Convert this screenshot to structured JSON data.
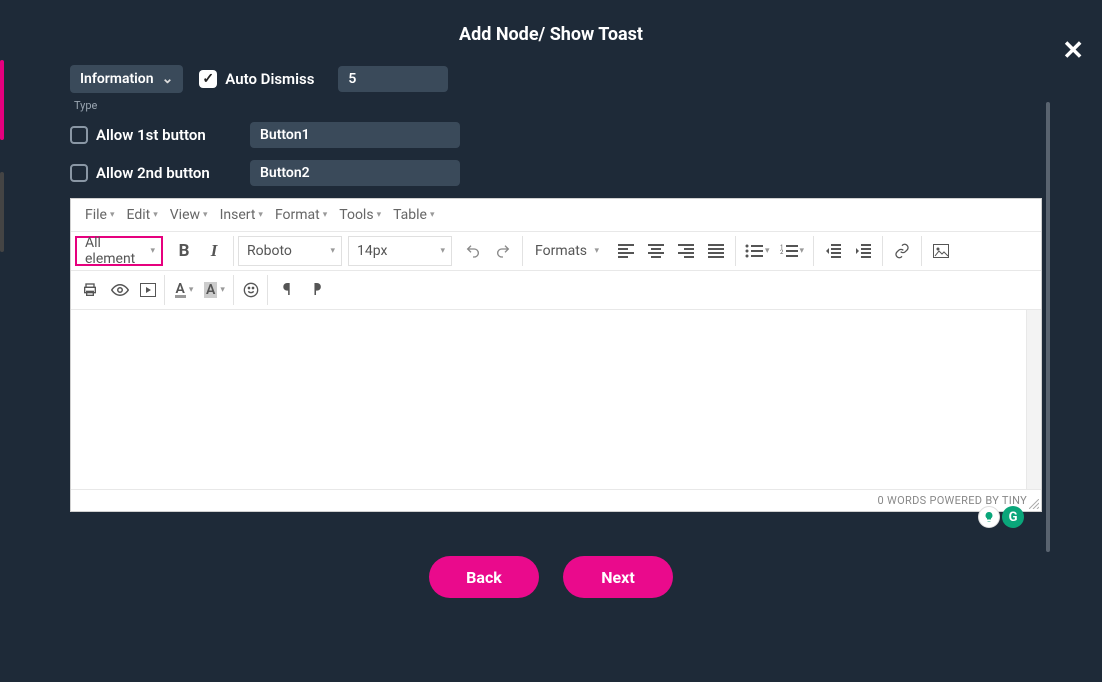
{
  "modal": {
    "title": "Add Node/ Show Toast",
    "type_select": "Information",
    "type_hint": "Type",
    "auto_dismiss_label": "Auto Dismiss",
    "auto_dismiss_checked": true,
    "auto_dismiss_value": "5",
    "allow1_label": "Allow 1st button",
    "allow1_name": "Button1",
    "allow2_label": "Allow 2nd button",
    "allow2_name": "Button2"
  },
  "editor": {
    "menus": [
      "File",
      "Edit",
      "View",
      "Insert",
      "Format",
      "Tools",
      "Table"
    ],
    "element_dropdown": "All element",
    "font_family": "Roboto",
    "font_size": "14px",
    "formats_dropdown": "Formats",
    "status_words": "0 WORDS",
    "status_brand": "POWERED BY TINY"
  },
  "footer": {
    "back": "Back",
    "next": "Next"
  }
}
